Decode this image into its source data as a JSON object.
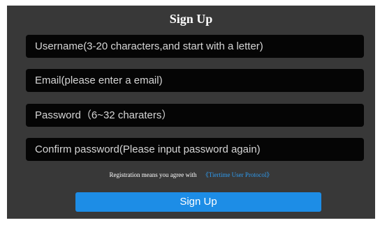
{
  "form": {
    "title": "Sign Up",
    "username_placeholder": "Username(3-20 characters,and start with a letter)",
    "email_placeholder": "Email(please enter a email)",
    "password_placeholder": "Password（6~32 charaters）",
    "confirm_placeholder": "Confirm password(Please input password again)",
    "agreement_text": "Registration means you agree with",
    "agreement_link": "《Tiertime User Protocol》",
    "submit_label": "Sign Up"
  },
  "colors": {
    "panel_background": "#383838",
    "input_background": "#050505",
    "accent": "#1d8de6",
    "link": "#2f9bef"
  }
}
